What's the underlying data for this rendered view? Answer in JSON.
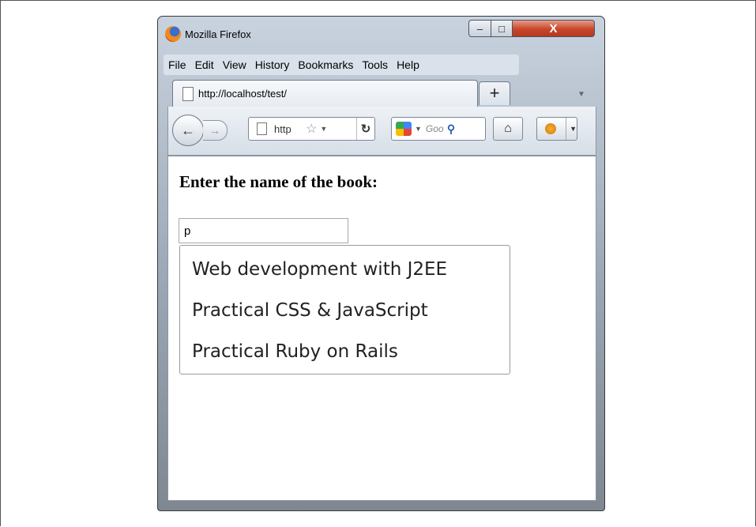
{
  "window": {
    "title": "Mozilla Firefox",
    "controls": {
      "minimize": "–",
      "maximize": "□",
      "close": "X"
    }
  },
  "menubar": {
    "items": [
      "File",
      "Edit",
      "View",
      "History",
      "Bookmarks",
      "Tools",
      "Help"
    ]
  },
  "tabs": {
    "active_label": "http://localhost/test/",
    "new_tab_label": "+"
  },
  "navbar": {
    "url_display": "http",
    "search_placeholder": "Goo",
    "icons": [
      "back-icon",
      "forward-icon",
      "page-icon",
      "star-icon",
      "reload-icon",
      "google-icon",
      "search-icon",
      "home-icon",
      "firebug-icon"
    ]
  },
  "page": {
    "heading": "Enter the name of the book:",
    "input_value": "p",
    "suggestions": [
      "Web development with J2EE",
      "Practical CSS & JavaScript",
      "Practical Ruby on Rails"
    ]
  },
  "colors": {
    "window_chrome": "#9aa6b4",
    "close_button": "#c8452a",
    "content_bg": "#ffffff"
  }
}
